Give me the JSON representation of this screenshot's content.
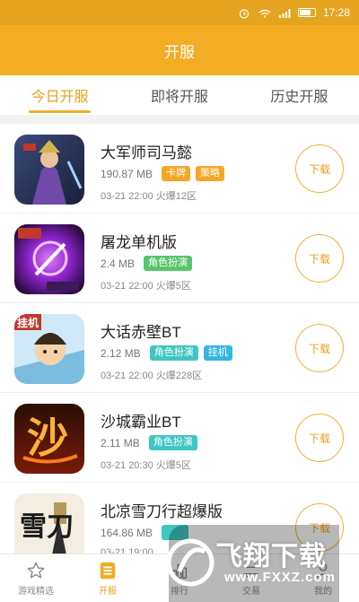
{
  "status_bar": {
    "time": "17:28"
  },
  "header": {
    "title": "开服"
  },
  "tabs": [
    {
      "label": "今日开服",
      "active": true
    },
    {
      "label": "即将开服",
      "active": false
    },
    {
      "label": "历史开服",
      "active": false
    }
  ],
  "games": [
    {
      "name": "大军师司马懿",
      "size": "190.87 MB",
      "tags": [
        {
          "label": "卡牌",
          "color": "orange"
        },
        {
          "label": "策略",
          "color": "orange"
        }
      ],
      "time": "03-21 22:00 火爆12区",
      "button": "下载",
      "icon_badge": ""
    },
    {
      "name": "屠龙单机版",
      "size": "2.4 MB",
      "tags": [
        {
          "label": "角色扮演",
          "color": "green"
        }
      ],
      "time": "03-21 22:00 火爆5区",
      "button": "下载",
      "icon_badge": ""
    },
    {
      "name": "大话赤壁BT",
      "size": "2.12 MB",
      "tags": [
        {
          "label": "角色扮演",
          "color": "teal"
        },
        {
          "label": "挂机",
          "color": "blue"
        }
      ],
      "time": "03-21 22:00 火爆228区",
      "button": "下载",
      "icon_badge": "挂机"
    },
    {
      "name": "沙城霸业BT",
      "size": "2.11 MB",
      "tags": [
        {
          "label": "角色扮演",
          "color": "teal"
        }
      ],
      "time": "03-21 20:30 火爆5区",
      "button": "下载",
      "icon_badge": "沙"
    },
    {
      "name": "北凉雪刀行超爆版",
      "size": "164.86 MB",
      "tags": [],
      "time": "03-21 19:00",
      "button": "下载",
      "icon_badge": "雪刀"
    }
  ],
  "bottom_nav": [
    {
      "label": "游戏精选",
      "icon": "star-icon",
      "active": false
    },
    {
      "label": "开服",
      "icon": "list-icon",
      "active": true
    },
    {
      "label": "排行",
      "icon": "rank-icon",
      "active": false
    },
    {
      "label": "交易",
      "icon": "trade-icon",
      "active": false
    },
    {
      "label": "我的",
      "icon": "user-icon",
      "active": false
    }
  ],
  "watermark": {
    "text": "飞翔下载",
    "url": "www.FXXZ.com"
  },
  "colors": {
    "header": "#f2ad24",
    "status_bar": "#e5a41f",
    "accent": "#e9a21e"
  }
}
